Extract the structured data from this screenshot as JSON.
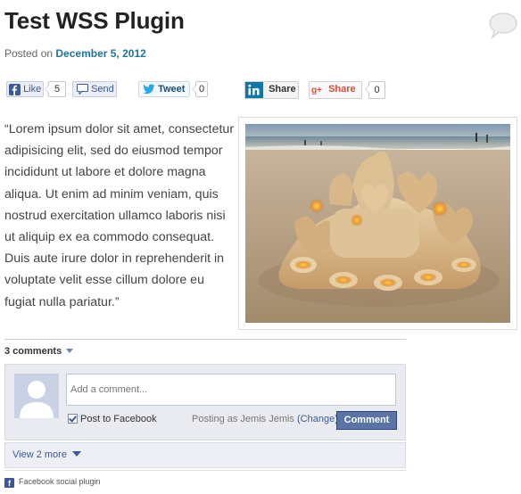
{
  "post": {
    "title": "Test WSS Plugin",
    "posted_prefix": "Posted on",
    "date": "December 5, 2012",
    "body": "“Lorem ipsum dolor sit amet, consectetur adipisicing elit, sed do eiusmod tempor incididunt ut labore et dolore magna aliqua. Ut enim ad minim veniam, quis nostrud exercitation ullamco laboris nisi ut aliquip ex ea commodo consequat. Duis aute irure dolor in reprehenderit in voluptate velit esse cillum dolore eu fugiat nulla pariatur.”"
  },
  "share": {
    "facebook": {
      "like_label": "Like",
      "like_count": "5",
      "send_label": "Send"
    },
    "twitter": {
      "label": "Tweet",
      "count": "0"
    },
    "linkedin": {
      "label": "Share"
    },
    "google": {
      "label": "Share",
      "count": "0"
    }
  },
  "comments": {
    "count_label": "3 comments",
    "input_placeholder": "Add a comment...",
    "post_to_facebook_label": "Post to Facebook",
    "posting_as_label": "Posting as Jemis Jemis",
    "change_label": "(Change)",
    "comment_button_label": "Comment",
    "view_more_label": "View 2 more",
    "footer_label": "Facebook social plugin"
  },
  "icons": {
    "comment_bubble": "speech-bubble-icon",
    "facebook": "facebook-icon",
    "send": "send-icon",
    "twitter": "twitter-bird-icon",
    "linkedin": "linkedin-icon",
    "google_plus": "google-plus-icon"
  },
  "colors": {
    "link_blue": "#21759b",
    "facebook_blue": "#3b5998",
    "comment_button": "#5b74a8",
    "linkedin_blue": "#0e76a8",
    "google_red": "#dd4b39"
  }
}
